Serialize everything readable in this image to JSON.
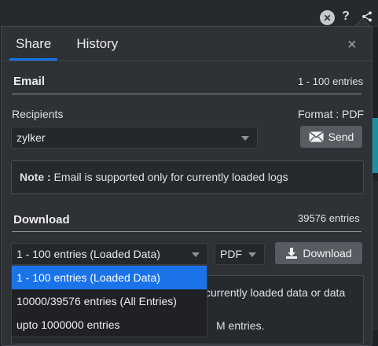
{
  "toolbar": {
    "help_label": "?"
  },
  "tabs": [
    {
      "label": "Share",
      "active": true
    },
    {
      "label": "History",
      "active": false
    }
  ],
  "close_label": "×",
  "email": {
    "title": "Email",
    "entries": "1 - 100 entries",
    "recipients_label": "Recipients",
    "format_label": "Format : PDF",
    "recipient_value": "zylker",
    "send_label": "Send",
    "note_bold": "Note :",
    "note_text": " Email is supported only for currently loaded logs"
  },
  "download": {
    "title": "Download",
    "entries": "39576 entries",
    "range_value": "1 - 100 entries (Loaded Data)",
    "format_value": "PDF",
    "download_label": "Download",
    "note_partial_1": "currently loaded data or data",
    "note_partial_2": "M entries.",
    "options": [
      {
        "label": "1 - 100 entries (Loaded Data)",
        "selected": true
      },
      {
        "label": "10000/39576 entries (All Entries)",
        "selected": false
      },
      {
        "label": "upto 1000000 entries",
        "selected": false
      }
    ]
  },
  "colors": {
    "accent": "#1a73e8",
    "panel": "#2e3136",
    "button": "#585c62"
  }
}
